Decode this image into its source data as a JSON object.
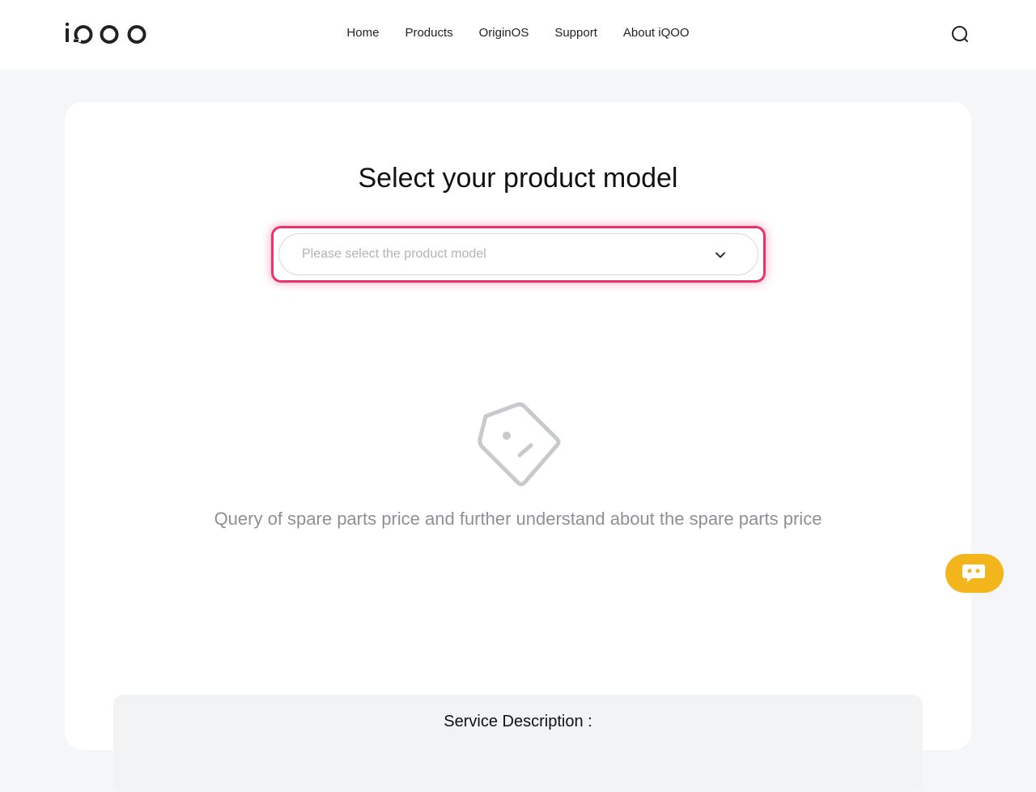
{
  "header": {
    "logo_text": "iQOO",
    "nav": [
      {
        "label": "Home"
      },
      {
        "label": "Products"
      },
      {
        "label": "OriginOS"
      },
      {
        "label": "Support"
      },
      {
        "label": "About iQOO"
      }
    ],
    "search_icon": "search-icon"
  },
  "main": {
    "title": "Select your product model",
    "select": {
      "placeholder": "Please select the product model",
      "value": "",
      "icon": "chevron-down-icon"
    },
    "empty_state": {
      "icon": "price-tag-icon",
      "text": "Query of spare parts price and further understand about the spare parts price"
    },
    "service": {
      "title": "Service Description :"
    }
  },
  "chat": {
    "icon": "chat-bot-icon"
  },
  "colors": {
    "focus_ring": "#e8336d",
    "chat_bg": "#f2b51c",
    "page_bg": "#f5f6f8"
  }
}
